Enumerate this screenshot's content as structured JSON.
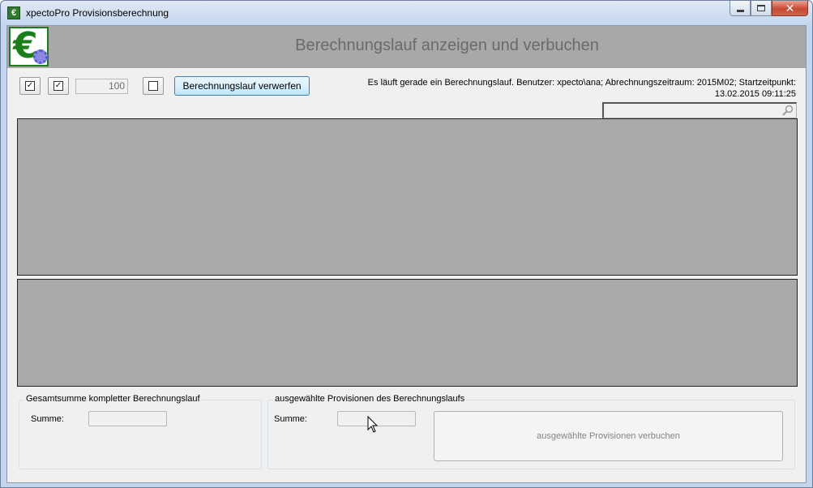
{
  "window": {
    "title": "xpectoPro Provisionsberechnung",
    "icon": "app-euro-icon",
    "controls": [
      "minimize-icon",
      "maximize-icon",
      "close-icon"
    ]
  },
  "banner": {
    "logo_text": "€",
    "title": "Berechnungslauf anzeigen und verbuchen"
  },
  "toolbar": {
    "checkbox1_checked": true,
    "checkbox2_checked": true,
    "count_value": "100",
    "checkbox3_checked": false,
    "discard_button_label": "Berechnungslauf verwerfen",
    "status_line1": "Es läuft gerade ein Berechnungslauf. Benutzer: xpecto\\ana; Abrechnungszeitraum: 2015M02;  Startzeitpunkt:",
    "status_line2": "13.02.2015 09:11:25",
    "search_value": ""
  },
  "grids": {
    "top_color": "#a9a9a9",
    "bottom_color": "#a9a9a9"
  },
  "totals": {
    "group_label": "Gesamtsumme kompletter Berechnungslauf",
    "sum_label": "Summe:",
    "sum_value": ""
  },
  "selected": {
    "group_label": "ausgewählte Provisionen des Berechnungslaufs",
    "sum_label": "Summe:",
    "sum_value": "",
    "book_button_label": "ausgewählte Provisionen verbuchen"
  }
}
